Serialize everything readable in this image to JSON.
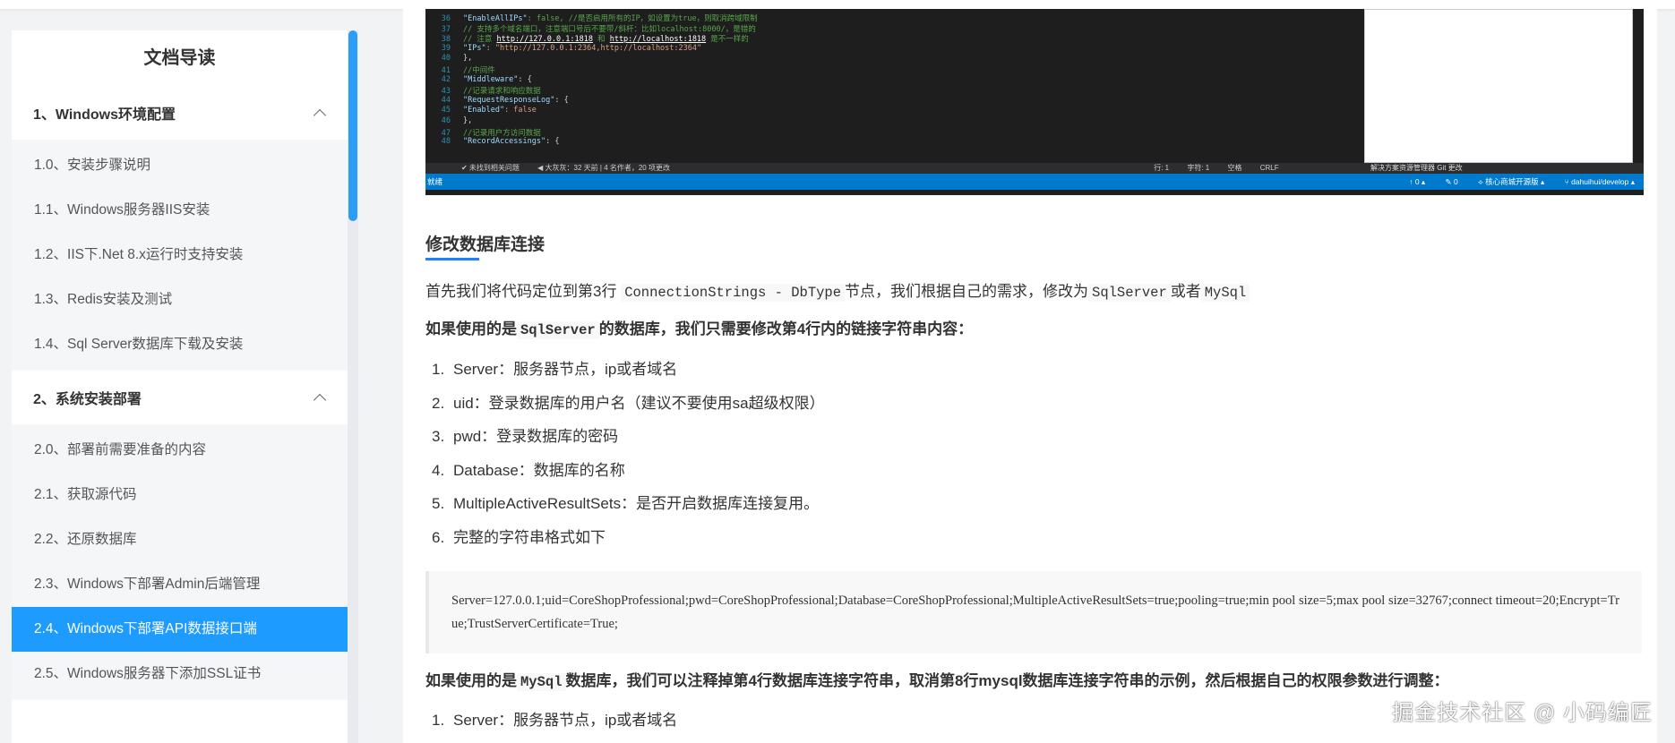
{
  "sidebar": {
    "title": "文档导读",
    "section1": "1、Windows环境配置",
    "section1_items": [
      "1.0、安装步骤说明",
      "1.1、Windows服务器IIS安装",
      "1.2、IIS下.Net 8.x运行时支持安装",
      "1.3、Redis安装及测试",
      "1.4、Sql Server数据库下载及安装"
    ],
    "section2": "2、系统安装部署",
    "section2_items": [
      "2.0、部署前需要准备的内容",
      "2.1、获取源代码",
      "2.2、还原数据库",
      "2.3、Windows下部署Admin后端管理",
      "2.4、Windows下部署API数据接口端",
      "2.5、Windows服务器下添加SSL证书"
    ],
    "active_index": 4
  },
  "screenshot": {
    "code_lines": [
      {
        "n": "36",
        "t1": "\"EnableAllIPs\"",
        "t2": ": false, //是否启用所有的IP，如设置为true，则取消跨域限制"
      },
      {
        "n": "37",
        "t1": "",
        "t2": "// 支持多个域名端口，注意端口号后不要带/斜杆：比如localhost:8000/，是错的"
      },
      {
        "n": "38",
        "t1": "// 注意 ",
        "u1": "http://127.0.0.1:1818",
        "t3": " 和 ",
        "u2": "http://localhost:1818",
        "t4": " 是不一样的"
      },
      {
        "n": "39",
        "t1": "\"IPs\"",
        "t2": ": \"http://127.0.0.1:2364,http://localhost:2364\""
      },
      {
        "n": "40",
        "t1": "},",
        "t2": ""
      },
      {
        "n": "41",
        "t1": "//中间件",
        "t2": ""
      },
      {
        "n": "42",
        "t1": "\"Middleware\"",
        "t2": ": {"
      },
      {
        "n": "43",
        "t1": "//记录请求和响应数据",
        "t2": ""
      },
      {
        "n": "44",
        "t1": "\"RequestResponseLog\"",
        "t2": ": {"
      },
      {
        "n": "45",
        "t1": "\"Enabled\"",
        "t2": ": false"
      },
      {
        "n": "46",
        "t1": "},",
        "t2": ""
      },
      {
        "n": "47",
        "t1": "//记录用户方访问数据",
        "t2": ""
      },
      {
        "n": "48",
        "t1": "\"RecordAccessings\"",
        "t2": ": {"
      }
    ],
    "bar_items": [
      "✔ 未找到相关问题",
      "◀ 大灰灰：32 天前 | 4 名作者，20 项更改",
      "行: 1",
      "字符: 1",
      "空格",
      "CRLF"
    ],
    "tabs": "解决方案资源管理器   Git 更改",
    "status_left": "就绪",
    "status_right": [
      "↑ 0 ▴",
      "✎ 0",
      "⟡ 核心商城开源版 ▴",
      "⑂ dahuihui/develop ▴"
    ]
  },
  "content": {
    "heading": "修改数据库连接",
    "p1_a": "首先我们将代码定位到第3行 ",
    "p1_code1": "ConnectionStrings - DbType",
    "p1_b": "节点，我们根据自己的需求，修改为",
    "p1_code2": "SqlServer",
    "p1_c": "或者",
    "p1_code3": "MySql",
    "p2_a": "如果使用的是",
    "p2_code": "SqlServer",
    "p2_b": "的数据库，我们只需要修改第4行内的链接字符串内容：",
    "list1": [
      {
        "num": "1.",
        "text": "Server：服务器节点，ip或者域名"
      },
      {
        "num": "2.",
        "text": "uid：登录数据库的用户名（建议不要使用sa超级权限）"
      },
      {
        "num": "3.",
        "text": "pwd：登录数据库的密码"
      },
      {
        "num": "4.",
        "text": "Database：数据库的名称"
      },
      {
        "num": "5.",
        "text": "MultipleActiveResultSets：是否开启数据库连接复用。"
      },
      {
        "num": "6.",
        "text": "完整的字符串格式如下"
      }
    ],
    "code_block": "Server=127.0.0.1;uid=CoreShopProfessional;pwd=CoreShopProfessional;Database=CoreShopProfessional;MultipleActiveResultSets=true;pooling=true;min pool size=5;max pool size=32767;connect timeout=20;Encrypt=True;TrustServerCertificate=True;",
    "p3_a": "如果使用的是",
    "p3_code": "MySql",
    "p3_b": "数据库，我们可以注释掉第4行数据库连接字符串，取消第8行mysql数据库连接字符串的示例，然后根据自己的权限参数进行调整：",
    "list2": [
      {
        "num": "1.",
        "text": "Server：服务器节点，ip或者域名"
      }
    ]
  },
  "watermark": "掘金技术社区 @ 小码编匠"
}
